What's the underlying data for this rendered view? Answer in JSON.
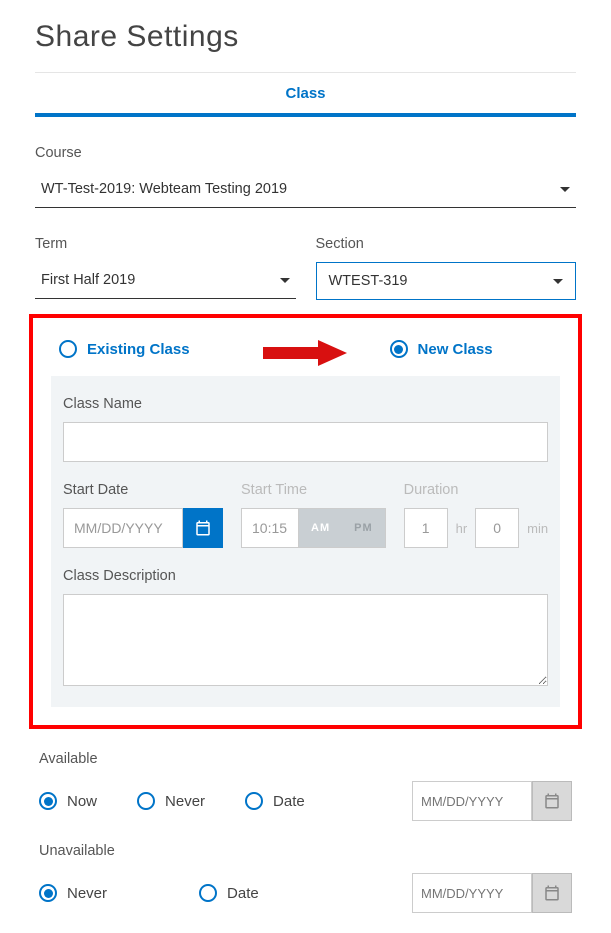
{
  "page_title": "Share Settings",
  "tab": {
    "label": "Class"
  },
  "course": {
    "label": "Course",
    "value": "WT-Test-2019: Webteam Testing 2019"
  },
  "term": {
    "label": "Term",
    "value": "First Half 2019"
  },
  "section": {
    "label": "Section",
    "value": "WTEST-319"
  },
  "class_type": {
    "existing_label": "Existing Class",
    "new_label": "New Class",
    "selected": "new"
  },
  "class_name": {
    "label": "Class Name",
    "value": ""
  },
  "start_date": {
    "label": "Start Date",
    "placeholder": "MM/DD/YYYY",
    "value": ""
  },
  "start_time": {
    "label": "Start Time",
    "placeholder": "10:15",
    "am": "AM",
    "pm": "PM"
  },
  "duration": {
    "label": "Duration",
    "hr_placeholder": "1",
    "hr_unit": "hr",
    "min_placeholder": "0",
    "min_unit": "min"
  },
  "class_description": {
    "label": "Class Description",
    "value": ""
  },
  "available": {
    "label": "Available",
    "options": {
      "now": "Now",
      "never": "Never",
      "date": "Date"
    },
    "selected": "now",
    "date_placeholder": "MM/DD/YYYY"
  },
  "unavailable": {
    "label": "Unavailable",
    "options": {
      "never": "Never",
      "date": "Date"
    },
    "selected": "never",
    "date_placeholder": "MM/DD/YYYY"
  }
}
